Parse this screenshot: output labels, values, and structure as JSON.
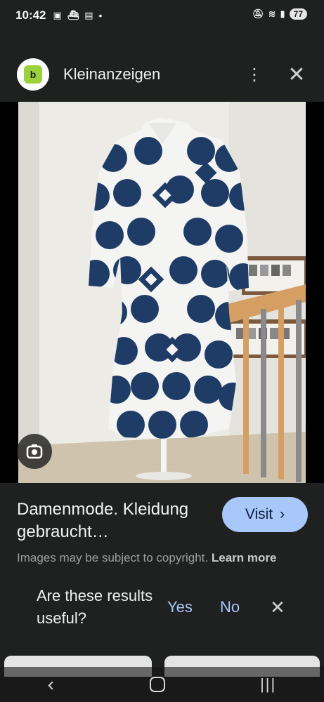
{
  "status_bar": {
    "time": "10:42",
    "battery": "77"
  },
  "header": {
    "site_name": "Kleinanzeigen",
    "logo_text": "b",
    "menu_icon": "more-vert-icon",
    "close_icon": "close-icon"
  },
  "result": {
    "title": "Damenmode. Kleidung gebraucht…",
    "visit_label": "Visit",
    "copyright_text": "Images may be subject to copyright.",
    "learn_more": "Learn more"
  },
  "feedback": {
    "question": "Are these results useful?",
    "yes": "Yes",
    "no": "No"
  },
  "colors": {
    "background": "#1f2120",
    "accent": "#a8c7fa",
    "dress_blue": "#1f3c66",
    "logo_green": "#9bd13b"
  }
}
